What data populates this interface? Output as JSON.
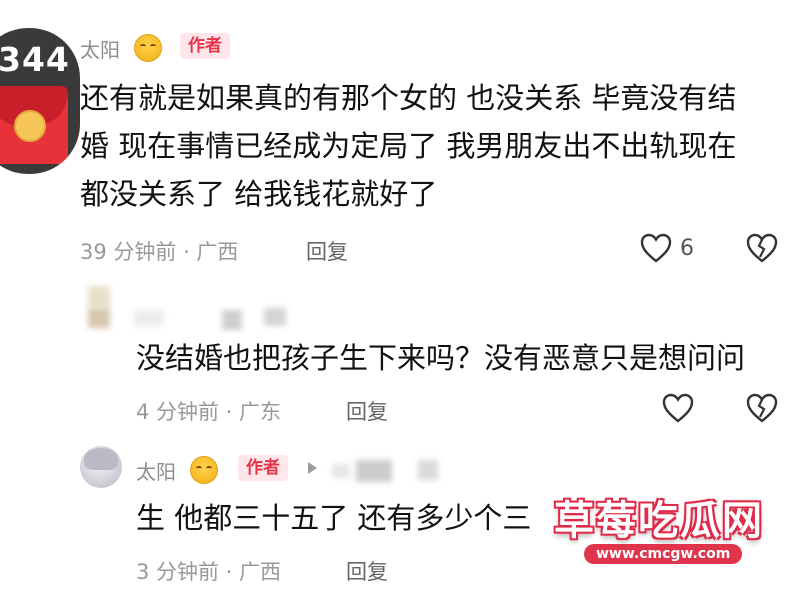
{
  "red_packet": {
    "count": "344",
    "icon": "red-envelope-icon"
  },
  "comment1": {
    "username": "太阳",
    "author_tag": "作者",
    "lines": [
      "还有就是如果真的有那个女的 也没关系 毕竟没有结",
      "婚 现在事情已经成为定局了 我男朋友出不出轨现在",
      "都没关系了 给我钱花就好了"
    ],
    "meta": "39 分钟前 · 广西",
    "reply": "回复",
    "likes": "6"
  },
  "reply1": {
    "text": "没结婚也把孩子生下来吗？没有恶意只是想问问",
    "meta": "4 分钟前 · 广东",
    "reply": "回复"
  },
  "reply2": {
    "username": "太阳",
    "author_tag": "作者",
    "text": "生 他都三十五了 还有多少个三",
    "meta": "3 分钟前 · 广西",
    "reply": "回复"
  },
  "watermark": {
    "title": "草莓吃瓜网",
    "url": "www.cmcgw.com"
  },
  "colors": {
    "author_tag": "#e8334a",
    "packet_red": "#e8323a",
    "meta_gray": "#999999"
  }
}
